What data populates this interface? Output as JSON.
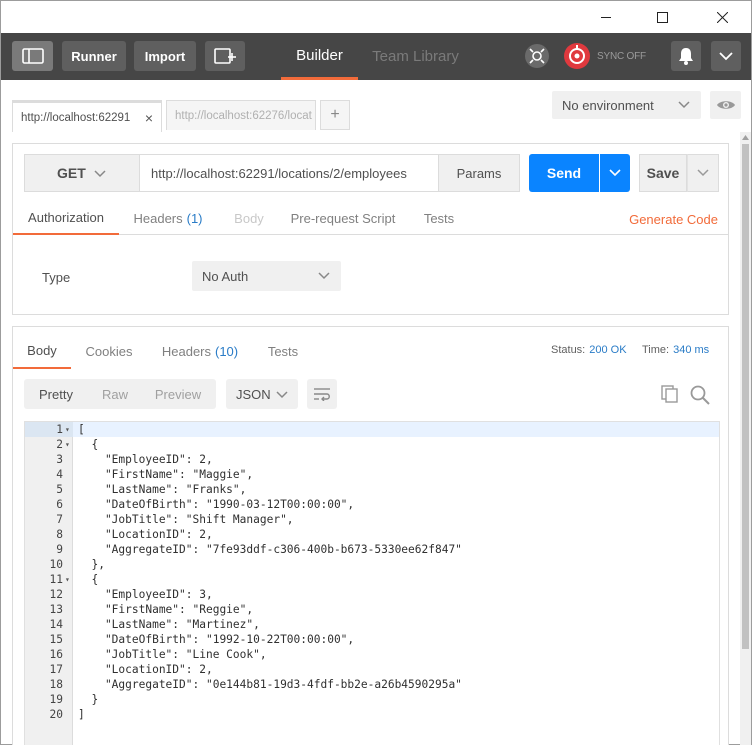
{
  "window": {
    "minimize_icon": "minimize-icon",
    "maximize_icon": "maximize-icon",
    "close_icon": "close-icon"
  },
  "header": {
    "runner_label": "Runner",
    "import_label": "Import",
    "builder_label": "Builder",
    "team_library_label": "Team Library",
    "sync_label": "SYNC OFF",
    "accent_color": "#f26b3a"
  },
  "tabs": {
    "active_label": "http://localhost:62291",
    "inactive_label": "http://localhost:62276/locat",
    "add_label": "+",
    "close_label": "×"
  },
  "environment": {
    "selected": "No environment"
  },
  "request": {
    "method": "GET",
    "url": "http://localhost:62291/locations/2/employees",
    "params_label": "Params",
    "send_label": "Send",
    "save_label": "Save",
    "send_color": "#0a84ff",
    "subtabs": {
      "authorization": "Authorization",
      "headers": "Headers",
      "headers_count": "(1)",
      "body": "Body",
      "prerequest": "Pre-request Script",
      "tests": "Tests"
    },
    "generate_code_label": "Generate Code",
    "type_label": "Type",
    "auth_type": "No Auth"
  },
  "response": {
    "tabs": {
      "body": "Body",
      "cookies": "Cookies",
      "headers": "Headers",
      "headers_count": "(10)",
      "tests": "Tests"
    },
    "status_label": "Status:",
    "status_value": "200 OK",
    "time_label": "Time:",
    "time_value": "340 ms",
    "view_modes": {
      "pretty": "Pretty",
      "raw": "Raw",
      "preview": "Preview"
    },
    "format": "JSON",
    "code_lines": [
      {
        "n": "1",
        "fold": "▾",
        "text": "["
      },
      {
        "n": "2",
        "fold": "▾",
        "text": "  {"
      },
      {
        "n": "3",
        "fold": "",
        "text": "    \"EmployeeID\": 2,"
      },
      {
        "n": "4",
        "fold": "",
        "text": "    \"FirstName\": \"Maggie\","
      },
      {
        "n": "5",
        "fold": "",
        "text": "    \"LastName\": \"Franks\","
      },
      {
        "n": "6",
        "fold": "",
        "text": "    \"DateOfBirth\": \"1990-03-12T00:00:00\","
      },
      {
        "n": "7",
        "fold": "",
        "text": "    \"JobTitle\": \"Shift Manager\","
      },
      {
        "n": "8",
        "fold": "",
        "text": "    \"LocationID\": 2,"
      },
      {
        "n": "9",
        "fold": "",
        "text": "    \"AggregateID\": \"7fe93ddf-c306-400b-b673-5330ee62f847\""
      },
      {
        "n": "10",
        "fold": "",
        "text": "  },"
      },
      {
        "n": "11",
        "fold": "▾",
        "text": "  {"
      },
      {
        "n": "12",
        "fold": "",
        "text": "    \"EmployeeID\": 3,"
      },
      {
        "n": "13",
        "fold": "",
        "text": "    \"FirstName\": \"Reggie\","
      },
      {
        "n": "14",
        "fold": "",
        "text": "    \"LastName\": \"Martinez\","
      },
      {
        "n": "15",
        "fold": "",
        "text": "    \"DateOfBirth\": \"1992-10-22T00:00:00\","
      },
      {
        "n": "16",
        "fold": "",
        "text": "    \"JobTitle\": \"Line Cook\","
      },
      {
        "n": "17",
        "fold": "",
        "text": "    \"LocationID\": 2,"
      },
      {
        "n": "18",
        "fold": "",
        "text": "    \"AggregateID\": \"0e144b81-19d3-4fdf-bb2e-a26b4590295a\""
      },
      {
        "n": "19",
        "fold": "",
        "text": "  }"
      },
      {
        "n": "20",
        "fold": "",
        "text": "]"
      }
    ]
  }
}
